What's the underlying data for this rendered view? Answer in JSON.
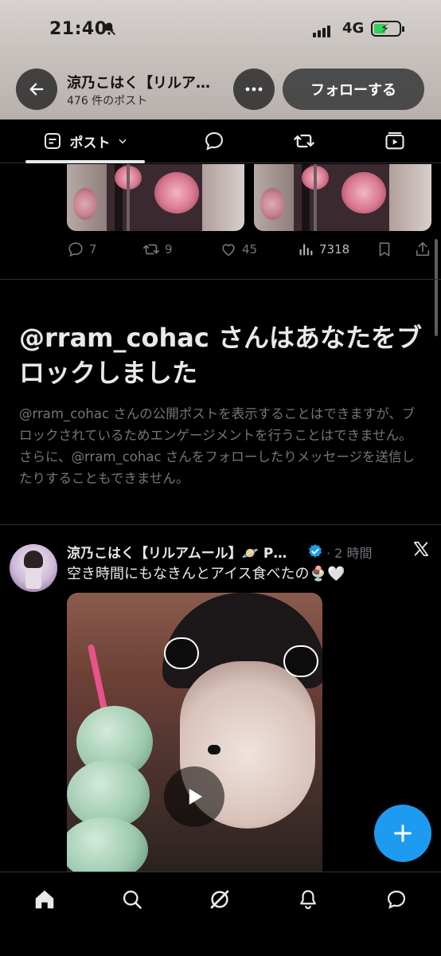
{
  "status_bar": {
    "time": "21:40",
    "network": "4G"
  },
  "header": {
    "title": "涼乃こはく【リルア…",
    "post_count": "476 件のポスト",
    "follow_label": "フォローする"
  },
  "tabs": {
    "posts_label": "ポスト"
  },
  "prev_post": {
    "replies": "7",
    "reposts": "9",
    "likes": "45",
    "views": "7318"
  },
  "blocked": {
    "title": "@rram_cohac さんはあなたをブロックしました",
    "description": "@rram_cohac さんの公開ポストを表示することはできますが、ブロックされているためエンゲージメントを行うことはできません。さらに、@rram_cohac さんをフォローしたりメッセージを送信したりすることもできません。"
  },
  "tweet": {
    "author": "涼乃こはく【リルアムール】🪐 P…",
    "time": "· 2 時間",
    "text": "空き時間にもなきんとアイス食べたの🍨🤍"
  },
  "icons": {
    "back": "arrow-left-icon",
    "more": "more-horizontal-icon",
    "x_logo": "x-logo-icon",
    "compose": "plus-icon"
  },
  "colors": {
    "accent": "#1d9bf0",
    "background": "#000000",
    "muted_text": "#71767b"
  }
}
